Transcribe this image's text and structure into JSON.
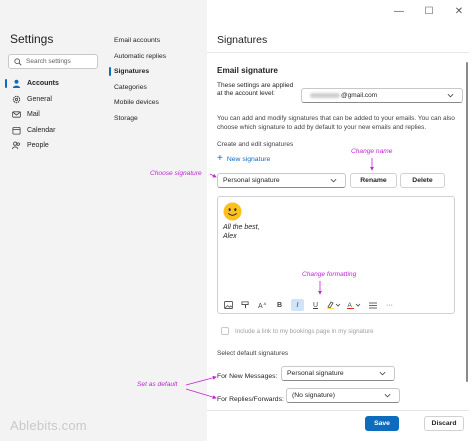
{
  "window": {
    "minimize_glyph": "—",
    "maximize_glyph": "☐",
    "close_glyph": "✕"
  },
  "sidebar": {
    "title": "Settings",
    "search_placeholder": "Search settings",
    "items": [
      {
        "label": "Accounts",
        "icon": "person-icon",
        "active": true
      },
      {
        "label": "General",
        "icon": "gear-icon",
        "active": false
      },
      {
        "label": "Mail",
        "icon": "mail-icon",
        "active": false
      },
      {
        "label": "Calendar",
        "icon": "calendar-icon",
        "active": false
      },
      {
        "label": "People",
        "icon": "people-icon",
        "active": false
      }
    ]
  },
  "subnav": {
    "items": [
      {
        "label": "Email accounts",
        "active": false
      },
      {
        "label": "Automatic replies",
        "active": false
      },
      {
        "label": "Signatures",
        "active": true
      },
      {
        "label": "Categories",
        "active": false
      },
      {
        "label": "Mobile devices",
        "active": false
      },
      {
        "label": "Storage",
        "active": false
      }
    ]
  },
  "main": {
    "title": "Signatures",
    "section_title": "Email signature",
    "applied_text": "These settings are applied at the account level:",
    "account_value": "@gmail.com",
    "description": "You can add and modify signatures that can be added to your emails. You can also choose which signature to add by default to your new emails and replies.",
    "create_label": "Create and edit signatures",
    "new_signature": "New signature",
    "signature_selected": "Personal signature",
    "rename_label": "Rename",
    "delete_label": "Delete",
    "editor": {
      "line1": "All the best,",
      "line2": "Alex",
      "emoji": "smiling-face-emoji"
    },
    "toolbar": {
      "bold": "B",
      "italic": "I",
      "underline": "U",
      "more": "···"
    },
    "bookings_checkbox": "Include a link to my bookings page in my signature",
    "default_title": "Select default signatures",
    "new_messages_label": "For New Messages:",
    "new_messages_value": "Personal signature",
    "replies_label": "For Replies/Forwards:",
    "replies_value": "(No signature)",
    "save_label": "Save",
    "discard_label": "Discard"
  },
  "annotations": {
    "choose_signature": "Choose signature",
    "change_name": "Change name",
    "change_formatting": "Change formatting",
    "set_as_default": "Set as default"
  },
  "brand": "Ablebits.com",
  "colors": {
    "accent": "#0f6cbd",
    "annotation": "#c026d3",
    "sidebar_bg": "#f3f3f3"
  }
}
